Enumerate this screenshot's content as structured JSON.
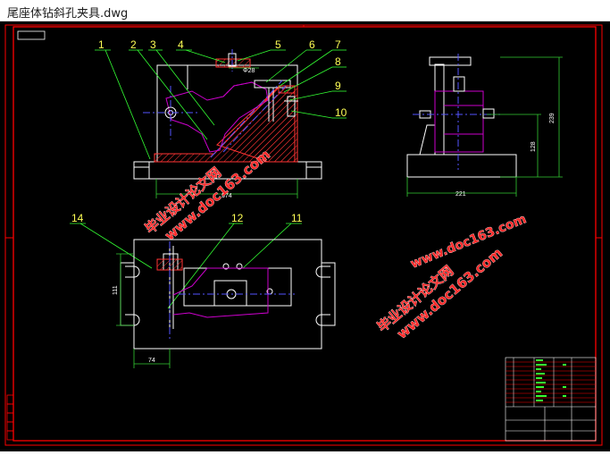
{
  "window": {
    "title": "尾座体钻斜孔夹具.dwg"
  },
  "drawing": {
    "callouts": [
      "1",
      "2",
      "3",
      "4",
      "5",
      "6",
      "7",
      "8",
      "9",
      "10",
      "11",
      "12",
      "14"
    ],
    "dimensions": {
      "front_width": "374",
      "front_hole": "Φ28",
      "side_width": "221",
      "side_height_total": "239",
      "side_height_mid": "128",
      "top_height": "111",
      "top_offset": "74"
    },
    "watermarks": [
      {
        "line1": "毕业设计论文网",
        "line2": "www.doc163.com"
      },
      {
        "line1": "毕业设计论文网",
        "line2": "www.doc163.com"
      },
      {
        "line1": "毕业设计论文网",
        "line2": "www.doc163.com"
      }
    ],
    "colors": {
      "background": "#000000",
      "frame": "#ff0000",
      "outline": "#ffffff",
      "workpiece": "#cc00cc",
      "hatch": "#ff3333",
      "center_line": "#5555ff",
      "leader": "#33ff33",
      "dimension": "#33cc33",
      "callout_text": "#ffff55"
    }
  }
}
